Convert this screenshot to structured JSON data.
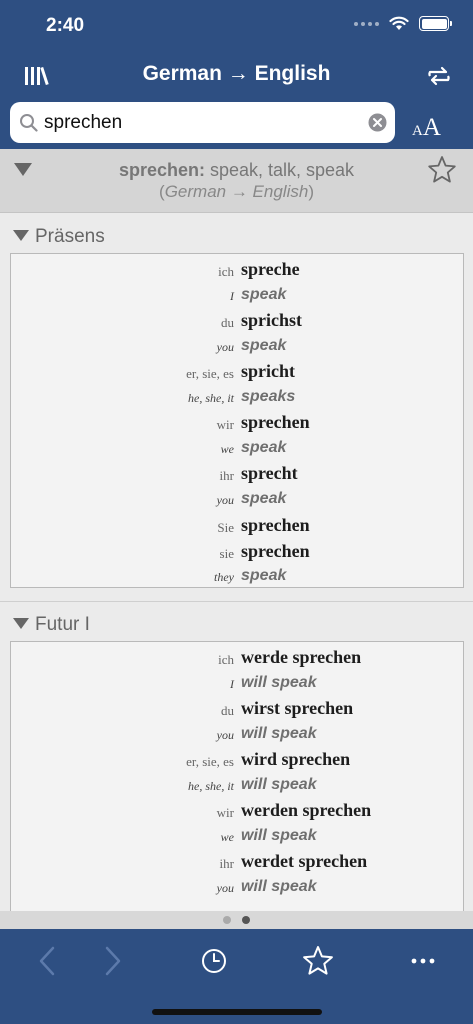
{
  "status": {
    "time": "2:40"
  },
  "nav": {
    "title": "German → English"
  },
  "search": {
    "value": "sprechen",
    "font_size_small": "A",
    "font_size_big": "A"
  },
  "entry": {
    "headword": "sprechen:",
    "translations": " speak, talk, speak",
    "open_paren": "(",
    "direction": "German → English",
    "close_paren": ")"
  },
  "sections": [
    {
      "title": "Präsens",
      "rows": [
        {
          "pronoun": "ich",
          "form": "spreche",
          "lang": "de"
        },
        {
          "pronoun": "I",
          "form": "speak",
          "lang": "en"
        },
        {
          "pronoun": "du",
          "form": "sprichst",
          "lang": "de"
        },
        {
          "pronoun": "you",
          "form": "speak",
          "lang": "en"
        },
        {
          "pronoun": "er, sie, es",
          "form": "spricht",
          "lang": "de"
        },
        {
          "pronoun": "he, she, it",
          "form": "speaks",
          "lang": "en"
        },
        {
          "pronoun": "wir",
          "form": "sprechen",
          "lang": "de"
        },
        {
          "pronoun": "we",
          "form": "speak",
          "lang": "en"
        },
        {
          "pronoun": "ihr",
          "form": "sprecht",
          "lang": "de"
        },
        {
          "pronoun": "you",
          "form": "speak",
          "lang": "en"
        },
        {
          "pronoun": "Sie",
          "form": "sprechen",
          "lang": "de"
        },
        {
          "pronoun": "sie",
          "form": "sprechen",
          "lang": "de"
        },
        {
          "pronoun": "they",
          "form": "speak",
          "lang": "en"
        }
      ]
    },
    {
      "title": "Futur I",
      "rows": [
        {
          "pronoun": "ich",
          "form": "werde sprechen",
          "lang": "de"
        },
        {
          "pronoun": "I",
          "form": "will speak",
          "lang": "en"
        },
        {
          "pronoun": "du",
          "form": "wirst sprechen",
          "lang": "de"
        },
        {
          "pronoun": "you",
          "form": "will speak",
          "lang": "en"
        },
        {
          "pronoun": "er, sie, es",
          "form": "wird sprechen",
          "lang": "de"
        },
        {
          "pronoun": "he, she, it",
          "form": "will speak",
          "lang": "en"
        },
        {
          "pronoun": "wir",
          "form": "werden sprechen",
          "lang": "de"
        },
        {
          "pronoun": "we",
          "form": "will speak",
          "lang": "en"
        },
        {
          "pronoun": "ihr",
          "form": "werdet sprechen",
          "lang": "de"
        },
        {
          "pronoun": "you",
          "form": "will speak",
          "lang": "en"
        }
      ]
    }
  ],
  "pager": {
    "active_page": 2,
    "page_count": 2
  },
  "tabbar": {
    "icons": [
      "chevron-left-icon",
      "chevron-right-icon",
      "clock-icon",
      "star-icon",
      "ellipsis-icon"
    ]
  },
  "colors": {
    "bar": "#2e4f82",
    "content": "#ebebeb",
    "header": "#d5d5d5",
    "english_form": "#6f6f6f"
  }
}
